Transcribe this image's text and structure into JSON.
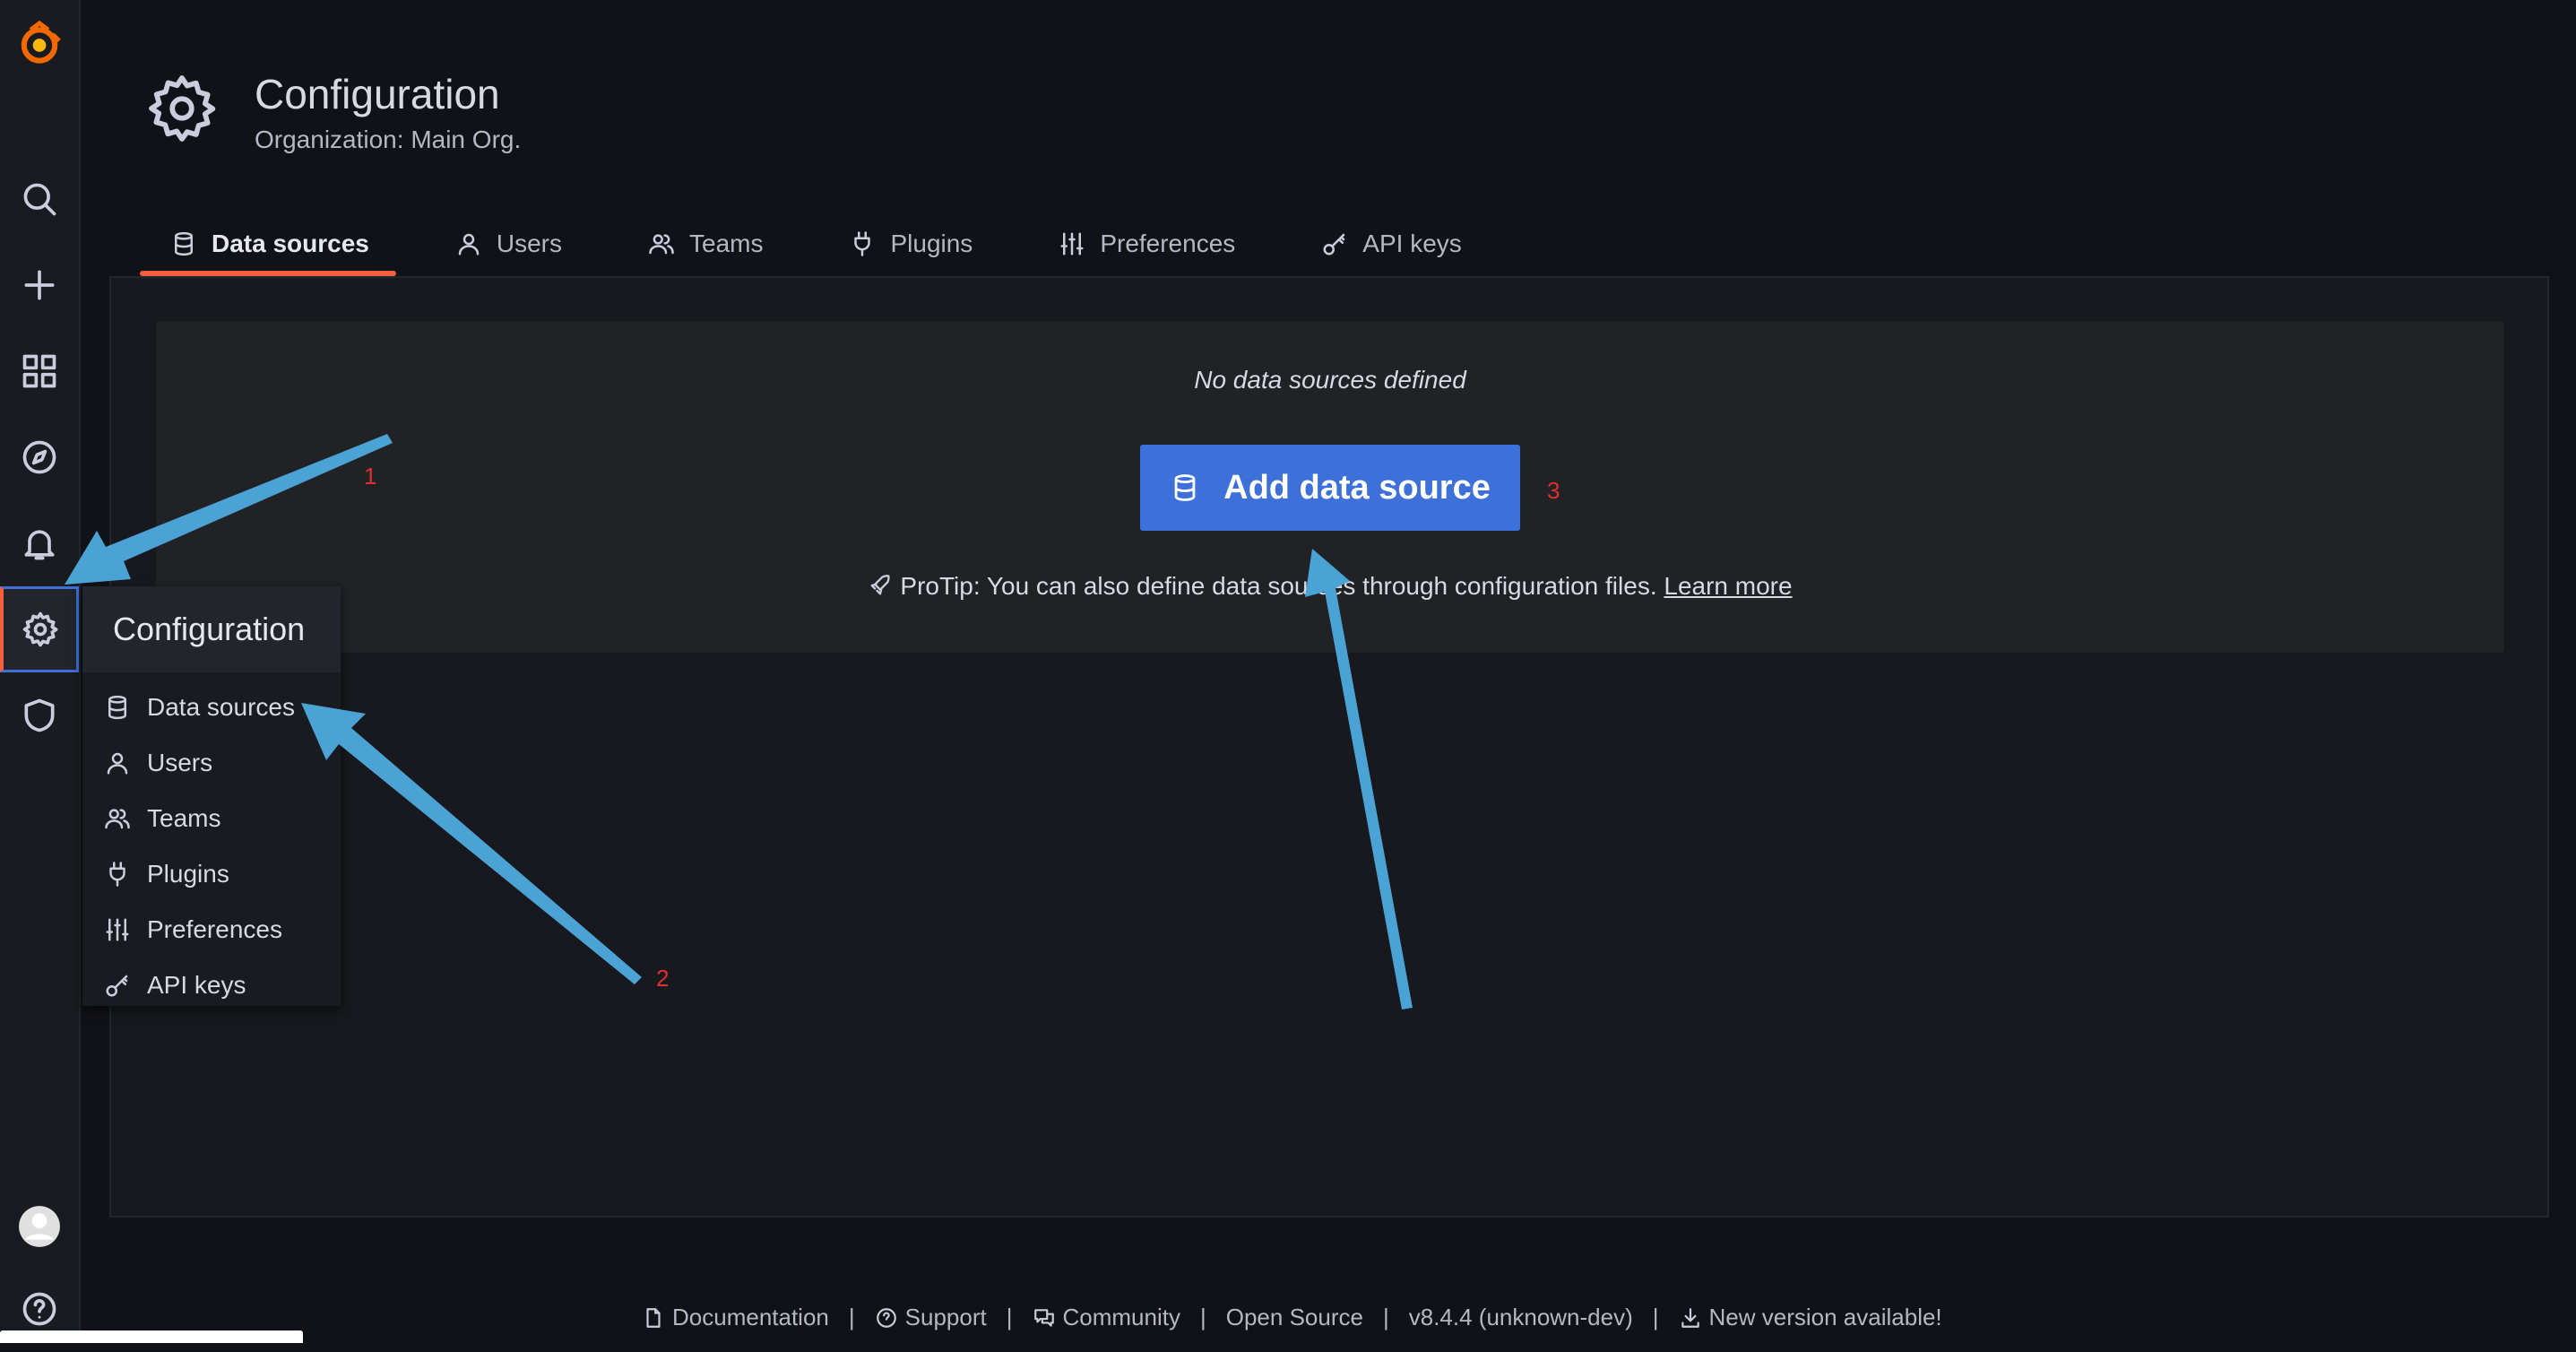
{
  "page": {
    "title": "Configuration",
    "subtitle": "Organization: Main Org."
  },
  "tabs": [
    {
      "label": "Data sources",
      "icon": "database-icon",
      "active": true
    },
    {
      "label": "Users",
      "icon": "user-icon"
    },
    {
      "label": "Teams",
      "icon": "users-icon"
    },
    {
      "label": "Plugins",
      "icon": "plug-icon"
    },
    {
      "label": "Preferences",
      "icon": "sliders-icon"
    },
    {
      "label": "API keys",
      "icon": "key-icon"
    }
  ],
  "empty_state": {
    "title": "No data sources defined",
    "button_label": "Add data source",
    "protip": "ProTip: You can also define data sources through configuration files.",
    "learn_more": "Learn more"
  },
  "menu": {
    "header": "Configuration",
    "items": [
      {
        "label": "Data sources",
        "icon": "database-icon"
      },
      {
        "label": "Users",
        "icon": "user-icon"
      },
      {
        "label": "Teams",
        "icon": "users-icon"
      },
      {
        "label": "Plugins",
        "icon": "plug-icon"
      },
      {
        "label": "Preferences",
        "icon": "sliders-icon"
      },
      {
        "label": "API keys",
        "icon": "key-icon"
      }
    ]
  },
  "footer": {
    "documentation": "Documentation",
    "support": "Support",
    "community": "Community",
    "open_source": "Open Source",
    "version": "v8.4.4 (unknown-dev)",
    "new_version": "New version available!",
    "separator": "|"
  },
  "annotations": [
    "1",
    "2",
    "3"
  ],
  "colors": {
    "accent": "#f55f3e",
    "primary_button": "#3d71d9",
    "arrow": "#4aa3d4",
    "annotation_number": "#e02f2f"
  }
}
